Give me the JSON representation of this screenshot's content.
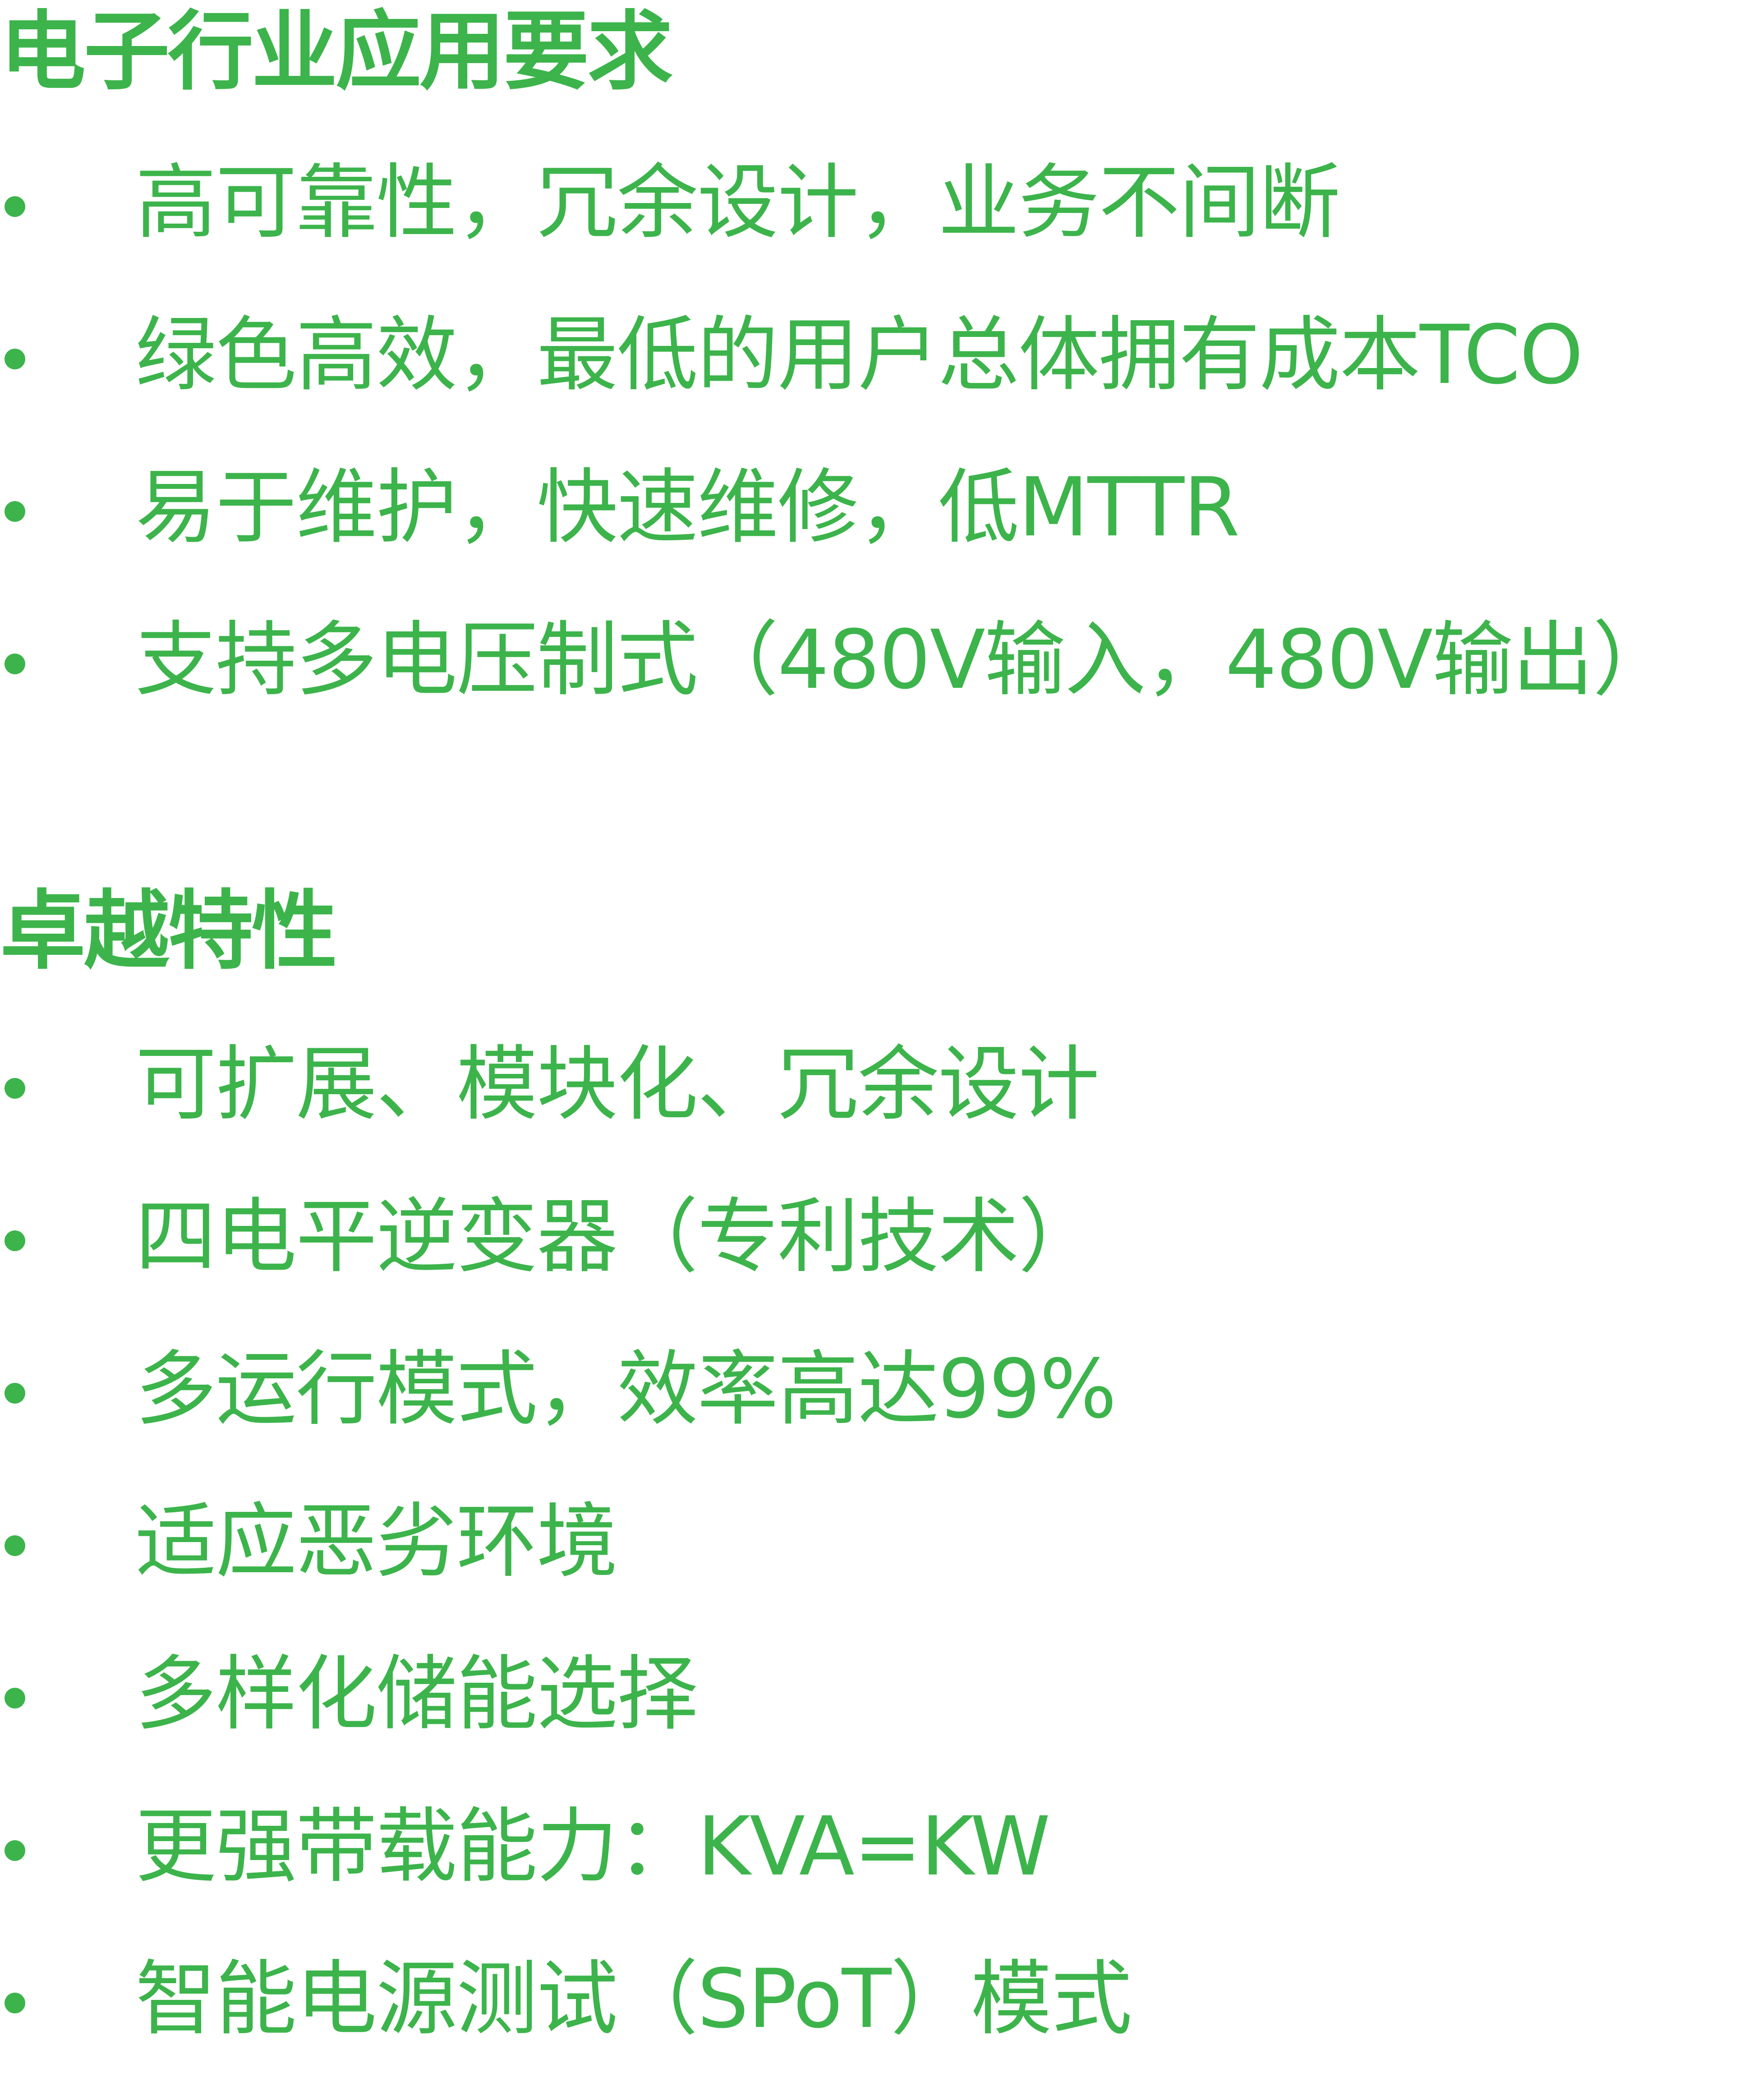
{
  "colors": {
    "text": "#3cb44b"
  },
  "sections": [
    {
      "heading": "电子行业应用要求",
      "items": [
        "高可靠性，冗余设计，业务不间断",
        "绿色高效，最低的用户总体拥有成本TCO",
        "易于维护，快速维修，低MTTR",
        "支持多电压制式（480V输入，480V输出）"
      ]
    },
    {
      "heading": "卓越特性",
      "items": [
        "可扩展、模块化、冗余设计",
        "四电平逆变器（专利技术）",
        "多运行模式，效率高达99%",
        "适应恶劣环境",
        "多样化储能选择",
        "更强带载能力：KVA=KW",
        "智能电源测试（SPoT）模式"
      ]
    }
  ]
}
